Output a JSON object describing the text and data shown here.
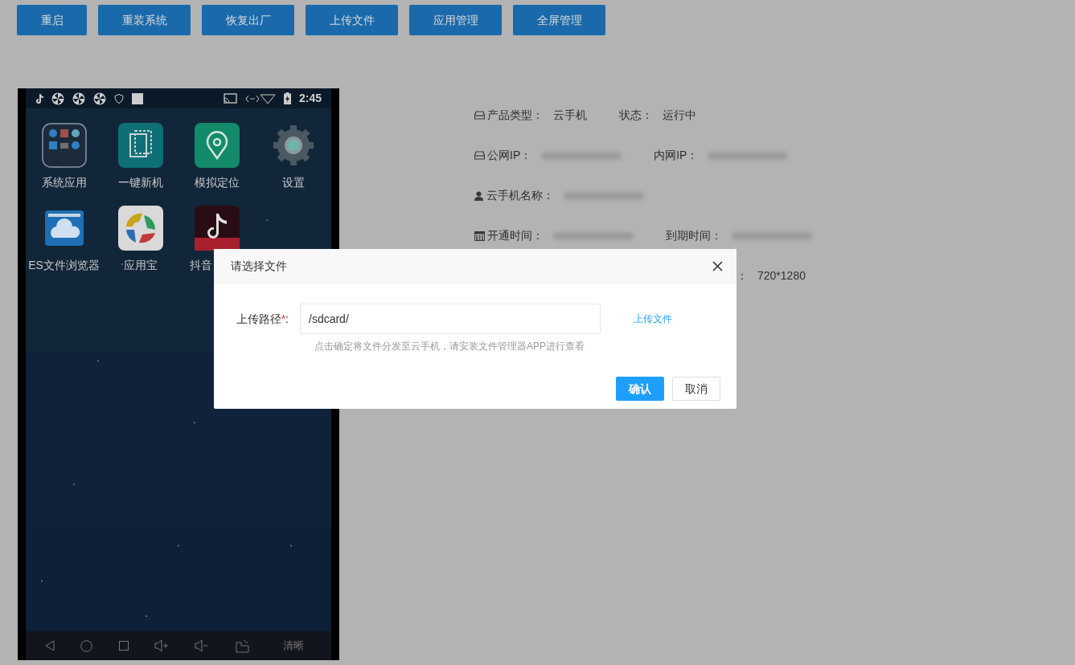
{
  "toolbar": [
    "重启",
    "重装系统",
    "恢复出厂",
    "上传文件",
    "应用管理",
    "全屏管理"
  ],
  "phone": {
    "time": "2:45",
    "apps": [
      {
        "label": "系统应用",
        "kind": "folder"
      },
      {
        "label": "一键新机",
        "kind": "device"
      },
      {
        "label": "模拟定位",
        "kind": "location"
      },
      {
        "label": "设置",
        "kind": "settings"
      },
      {
        "label": "ES文件浏览器",
        "kind": "files"
      },
      {
        "label": "应用宝",
        "kind": "store"
      },
      {
        "label": "抖音",
        "kind": "video"
      }
    ],
    "quality": "清晰"
  },
  "info": [
    {
      "items": [
        {
          "label": "产品类型：",
          "value": "云手机",
          "redacted": false
        },
        {
          "label": "状态：",
          "value": "运行中",
          "redacted": false
        }
      ]
    },
    {
      "items": [
        {
          "label": "公网IP：",
          "redacted": true
        },
        {
          "label": "内网IP：",
          "redacted": true
        }
      ]
    },
    {
      "items": [
        {
          "label": "云手机名称：",
          "redacted": true
        }
      ]
    },
    {
      "items": [
        {
          "label": "开通时间：",
          "redacted": true
        },
        {
          "label": "到期时间：",
          "redacted": true
        }
      ]
    },
    {
      "items": [
        {
          "label": "：",
          "value": "720*1280",
          "redacted": false
        }
      ]
    }
  ],
  "dialog": {
    "title": "请选择文件",
    "field_label": "上传路径",
    "required_mark": "*",
    "colon": ":",
    "value": "/sdcard/",
    "link": "上传文件",
    "hint": "点击确定将文件分发至云手机，请安装文件管理器APP进行查看",
    "buttons": [
      {
        "label": "确认",
        "kind": "primary"
      },
      {
        "label": "取消",
        "kind": "default"
      }
    ]
  }
}
